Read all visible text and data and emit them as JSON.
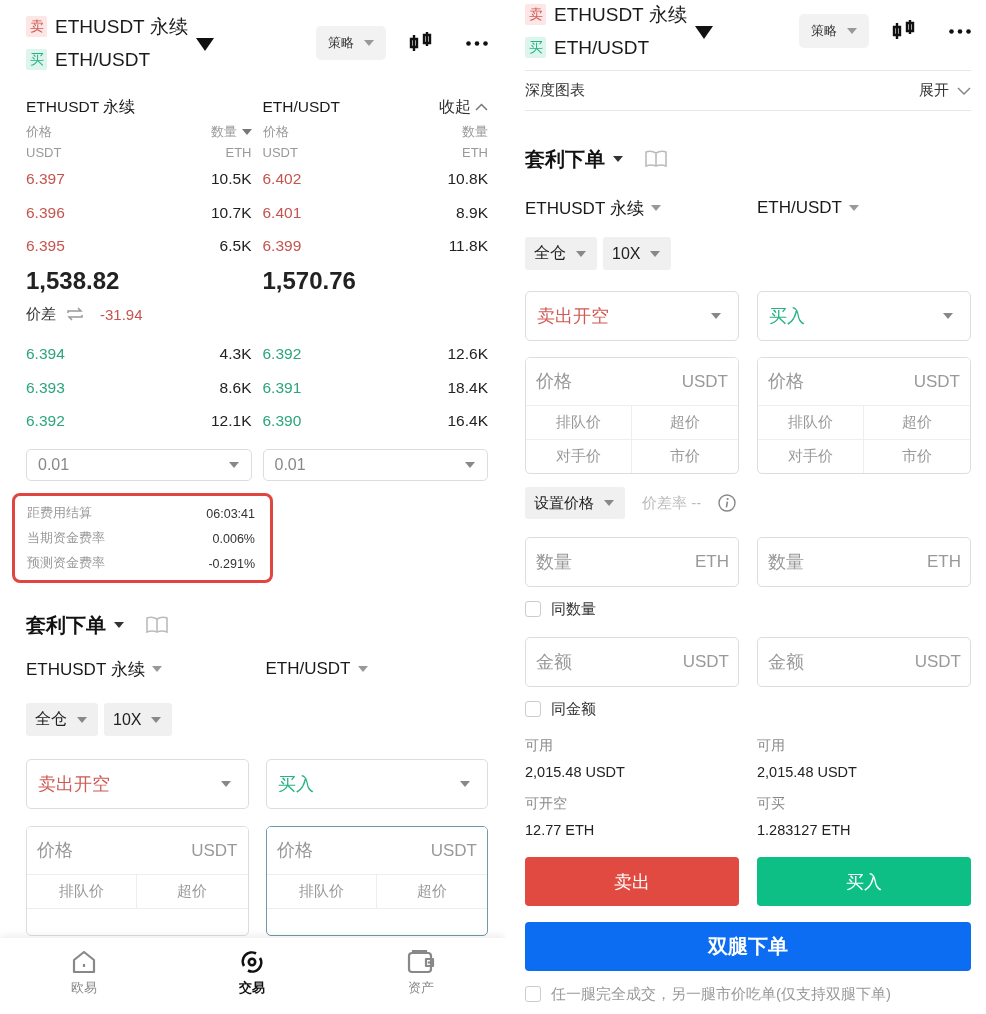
{
  "screens": [
    {
      "kind": "orderbook_view",
      "header": {
        "legs": [
          {
            "badge": "卖",
            "name": "ETHUSDT 永续",
            "kind": "sell"
          },
          {
            "badge": "买",
            "name": "ETH/USDT",
            "kind": "buy"
          }
        ],
        "strategy": "策略"
      },
      "order_book": {
        "collapse": "收起",
        "spread_label": "价差",
        "spread": "-31.94",
        "columns": [
          {
            "title": "ETHUSDT 永续",
            "price_label": "价格",
            "price_unit": "USDT",
            "qty_label": "数量",
            "qty_unit": "ETH",
            "qty_menu": true,
            "asks": [
              {
                "price": "6.397",
                "qty": "10.5K"
              },
              {
                "price": "6.396",
                "qty": "10.7K"
              },
              {
                "price": "6.395",
                "qty": "6.5K"
              }
            ],
            "last_price": "1,538.82",
            "bids": [
              {
                "price": "6.394",
                "qty": "4.3K"
              },
              {
                "price": "6.393",
                "qty": "8.6K"
              },
              {
                "price": "6.392",
                "qty": "12.1K"
              }
            ],
            "precision": "0.01"
          },
          {
            "title": "ETH/USDT",
            "price_label": "价格",
            "price_unit": "USDT",
            "qty_label": "数量",
            "qty_unit": "ETH",
            "qty_menu": false,
            "asks": [
              {
                "price": "6.402",
                "qty": "10.8K"
              },
              {
                "price": "6.401",
                "qty": "8.9K"
              },
              {
                "price": "6.399",
                "qty": "11.8K"
              }
            ],
            "last_price": "1,570.76",
            "bids": [
              {
                "price": "6.392",
                "qty": "12.6K"
              },
              {
                "price": "6.391",
                "qty": "18.4K"
              },
              {
                "price": "6.390",
                "qty": "16.4K"
              }
            ],
            "precision": "0.01"
          }
        ]
      },
      "funding": [
        {
          "label": "距费用结算",
          "value": "06:03:41"
        },
        {
          "label": "当期资金费率",
          "value": "0.006%"
        },
        {
          "label": "预测资金费率",
          "value": "-0.291%"
        }
      ],
      "order_form": {
        "title": "套利下单",
        "margin_mode": "全仓",
        "leverage": "10X",
        "legs": [
          {
            "name": "ETHUSDT 永续",
            "side_select": "卖出开空",
            "kind": "sell",
            "focused": false,
            "price": {
              "placeholder": "价格",
              "unit": "USDT"
            },
            "quick_prices": [
              "排队价",
              "超价"
            ]
          },
          {
            "name": "ETH/USDT",
            "side_select": "买入",
            "kind": "buy",
            "focused": true,
            "price": {
              "placeholder": "价格",
              "unit": "USDT"
            },
            "quick_prices": [
              "排队价",
              "超价"
            ]
          }
        ]
      },
      "bottom_nav": [
        {
          "label": "欧易",
          "selected": false
        },
        {
          "label": "交易",
          "selected": true
        },
        {
          "label": "资产",
          "selected": false
        }
      ]
    },
    {
      "kind": "form_view",
      "header": {
        "legs": [
          {
            "badge": "卖",
            "name": "ETHUSDT 永续",
            "kind": "sell"
          },
          {
            "badge": "买",
            "name": "ETH/USDT",
            "kind": "buy"
          }
        ],
        "strategy": "策略"
      },
      "depth_chart": {
        "label": "深度图表",
        "toggle": "展开"
      },
      "order_form": {
        "title": "套利下单",
        "margin_mode": "全仓",
        "leverage": "10X",
        "legs": [
          {
            "name": "ETHUSDT 永续",
            "side_select": "卖出开空",
            "kind": "sell",
            "focused": false,
            "price": {
              "placeholder": "价格",
              "unit": "USDT"
            },
            "quick_prices": [
              "排队价",
              "超价",
              "对手价",
              "市价"
            ],
            "quantity": {
              "placeholder": "数量",
              "unit": "ETH"
            },
            "amount": {
              "placeholder": "金额",
              "unit": "USDT"
            },
            "available": [
              {
                "label": "可用",
                "value": "2,015.48 USDT"
              },
              {
                "label": "可开空",
                "value": "12.77 ETH"
              }
            ],
            "submit": "卖出"
          },
          {
            "name": "ETH/USDT",
            "side_select": "买入",
            "kind": "buy",
            "focused": false,
            "price": {
              "placeholder": "价格",
              "unit": "USDT"
            },
            "quick_prices": [
              "排队价",
              "超价",
              "对手价",
              "市价"
            ],
            "quantity": {
              "placeholder": "数量",
              "unit": "ETH"
            },
            "amount": {
              "placeholder": "金额",
              "unit": "USDT"
            },
            "available": [
              {
                "label": "可用",
                "value": "2,015.48 USDT"
              },
              {
                "label": "可买",
                "value": "1.283127 ETH"
              }
            ],
            "submit": "买入"
          }
        ],
        "price_setting": {
          "label": "设置价格",
          "spread_rate": "价差率 --"
        },
        "same_quantity": {
          "label": "同数量",
          "checked": false
        },
        "same_amount": {
          "label": "同金额",
          "checked": false
        },
        "submit_both": "双腿下单",
        "auto_fill": {
          "label": "任一腿完全成交，另一腿市价吃单(仅支持双腿下单)",
          "checked": false
        }
      }
    }
  ]
}
